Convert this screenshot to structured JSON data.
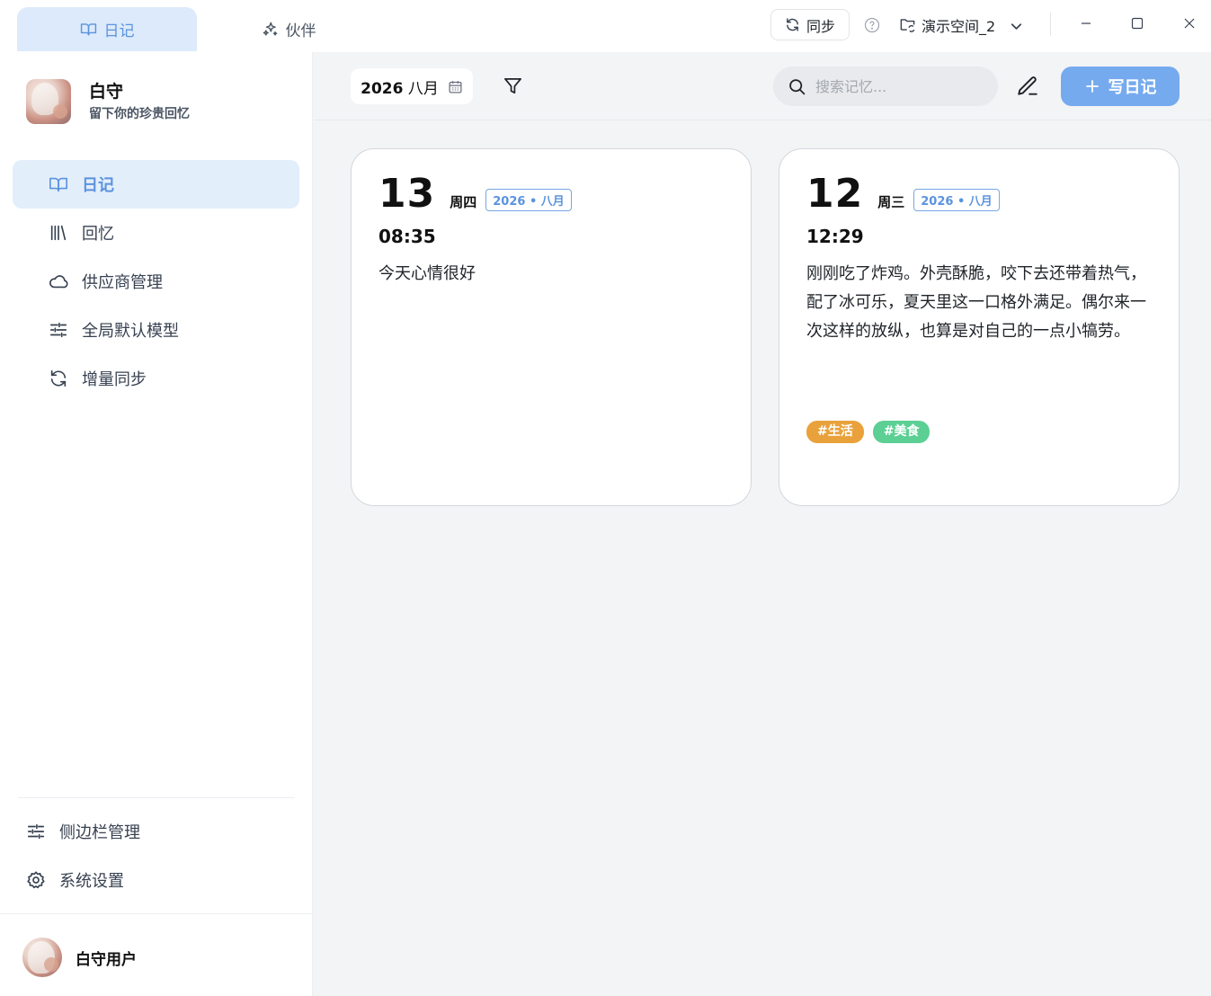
{
  "titlebar": {
    "tabs": [
      {
        "label": "日记",
        "icon": "book-icon"
      },
      {
        "label": "伙伴",
        "icon": "sparkle-icon"
      }
    ],
    "sync_label": "同步",
    "workspace_label": "演示空间_2"
  },
  "sidebar": {
    "app_name": "白守",
    "slogan": "留下你的珍贵回忆",
    "items": [
      {
        "label": "日记",
        "icon": "book-icon"
      },
      {
        "label": "回忆",
        "icon": "library-icon"
      },
      {
        "label": "供应商管理",
        "icon": "cloud-icon"
      },
      {
        "label": "全局默认模型",
        "icon": "sliders-icon"
      },
      {
        "label": "增量同步",
        "icon": "refresh-icon"
      }
    ],
    "bottom_items": [
      {
        "label": "侧边栏管理",
        "icon": "sliders-icon"
      },
      {
        "label": "系统设置",
        "icon": "gear-icon"
      }
    ],
    "user_name": "白守用户"
  },
  "toolbar": {
    "year": "2026",
    "month": "八月",
    "search_placeholder": "搜索记忆...",
    "write_label": "写日记"
  },
  "entries": [
    {
      "day": "13",
      "weekday": "周四",
      "badge": "2026 • 八月",
      "time": "08:35",
      "content": "今天心情很好",
      "tags": []
    },
    {
      "day": "12",
      "weekday": "周三",
      "badge": "2026 • 八月",
      "time": "12:29",
      "content": "刚刚吃了炸鸡。外壳酥脆，咬下去还带着热气，配了冰可乐，夏天里这一口格外满足。偶尔来一次这样的放纵，也算是对自己的一点小犒劳。",
      "tags": [
        {
          "label": "#生活",
          "color": "#e9a23b"
        },
        {
          "label": "#美食",
          "color": "#5ccf94"
        }
      ]
    }
  ],
  "colors": {
    "accent": "#5b93de",
    "accent_bg": "#e3eefb",
    "write_button": "#76aaee"
  }
}
